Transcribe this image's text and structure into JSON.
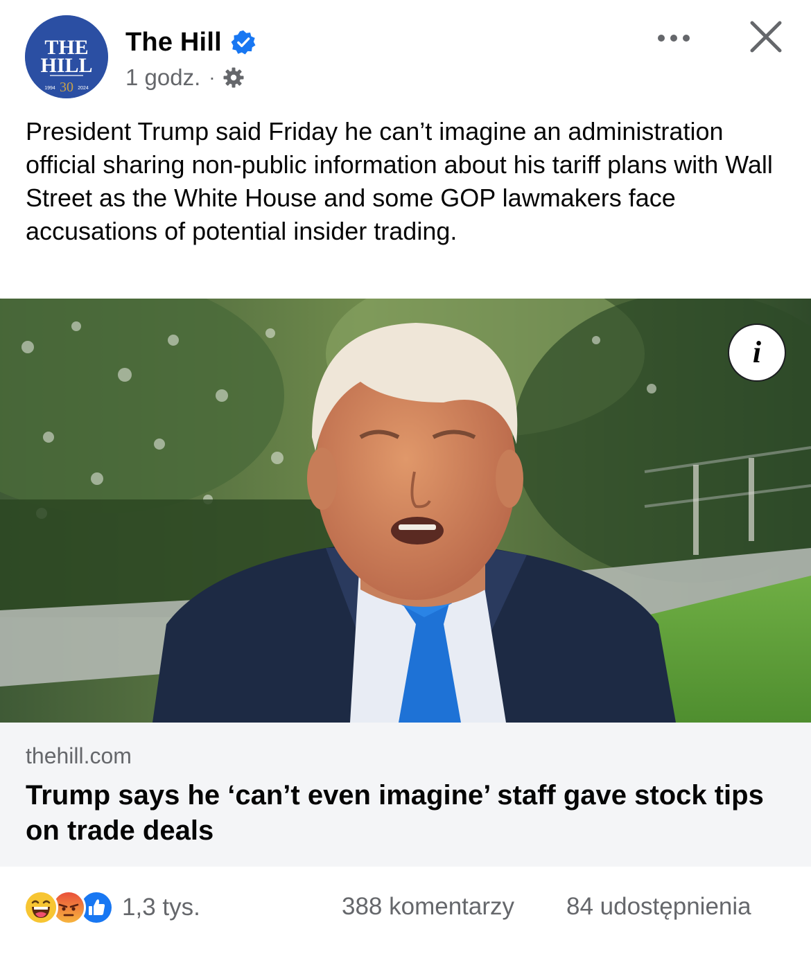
{
  "post": {
    "page_name": "The Hill",
    "verified": true,
    "timestamp": "1 godz.",
    "separator": "·",
    "audience_icon": "gear-icon",
    "avatar": {
      "line1": "THE",
      "line2": "HILL",
      "year_start": "1994",
      "anniversary": "30",
      "year_end": "2024"
    },
    "text": "President Trump said Friday he can’t imagine an administration official sharing non-public information about his tariff plans with Wall Street as the White House and some GOP lawmakers face accusations of potential insider trading."
  },
  "header_actions": {
    "more_icon": "more-horizontal-icon",
    "close_icon": "close-icon"
  },
  "link_preview": {
    "image_icon": "info-icon",
    "info_glyph": "i",
    "domain": "thehill.com",
    "title": "Trump says he ‘can’t even imagine’ staff gave stock tips on trade deals"
  },
  "footer": {
    "reaction_icons": [
      "haha-reaction-icon",
      "angry-reaction-icon",
      "like-reaction-icon"
    ],
    "reaction_count": "1,3 tys.",
    "comments": "388 komentarzy",
    "shares": "84 udostępnienia"
  },
  "colors": {
    "brand_blue": "#1877f2",
    "secondary_text": "#65676b",
    "link_box_bg": "#f4f5f7",
    "avatar_bg": "#2b4fa3",
    "gold": "#c9a24a"
  }
}
